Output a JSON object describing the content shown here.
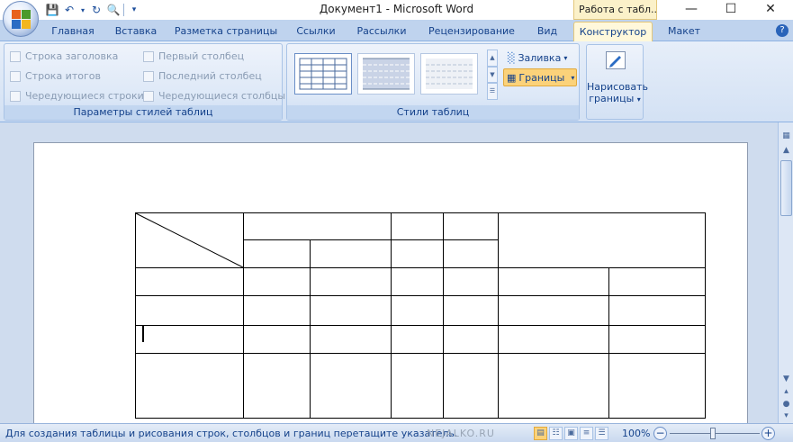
{
  "title_bar": {
    "title": "Документ1 - Microsoft Word",
    "context_tab": "Работа с табл..."
  },
  "window_controls": {
    "minimize_icon": "minimize-icon",
    "maximize_icon": "maximize-icon",
    "close_icon": "close-icon"
  },
  "tabs": [
    {
      "label": "Главная"
    },
    {
      "label": "Вставка"
    },
    {
      "label": "Разметка страницы"
    },
    {
      "label": "Ссылки"
    },
    {
      "label": "Рассылки"
    },
    {
      "label": "Рецензирование"
    },
    {
      "label": "Вид"
    },
    {
      "label": "Конструктор",
      "active": true
    },
    {
      "label": "Макет"
    }
  ],
  "ribbon": {
    "style_options": {
      "group_label": "Параметры стилей таблиц",
      "checkboxes": [
        {
          "label": "Строка заголовка"
        },
        {
          "label": "Строка итогов"
        },
        {
          "label": "Чередующиеся строки"
        },
        {
          "label": "Первый столбец"
        },
        {
          "label": "Последний столбец"
        },
        {
          "label": "Чередующиеся столбцы"
        }
      ]
    },
    "table_styles": {
      "group_label": "Стили таблиц",
      "shading_label": "Заливка",
      "borders_label": "Границы"
    },
    "draw_borders": {
      "label_line1": "Нарисовать",
      "label_line2": "границы"
    }
  },
  "status_bar": {
    "text": "Для создания таблицы и рисования строк, столбцов и границ перетащите указатель.",
    "watermark": "NEJALKO.RU",
    "zoom": "100%"
  },
  "colors": {
    "accent": "#15428b",
    "active_tab": "#fff8db",
    "highlight": "#fbd27a"
  }
}
